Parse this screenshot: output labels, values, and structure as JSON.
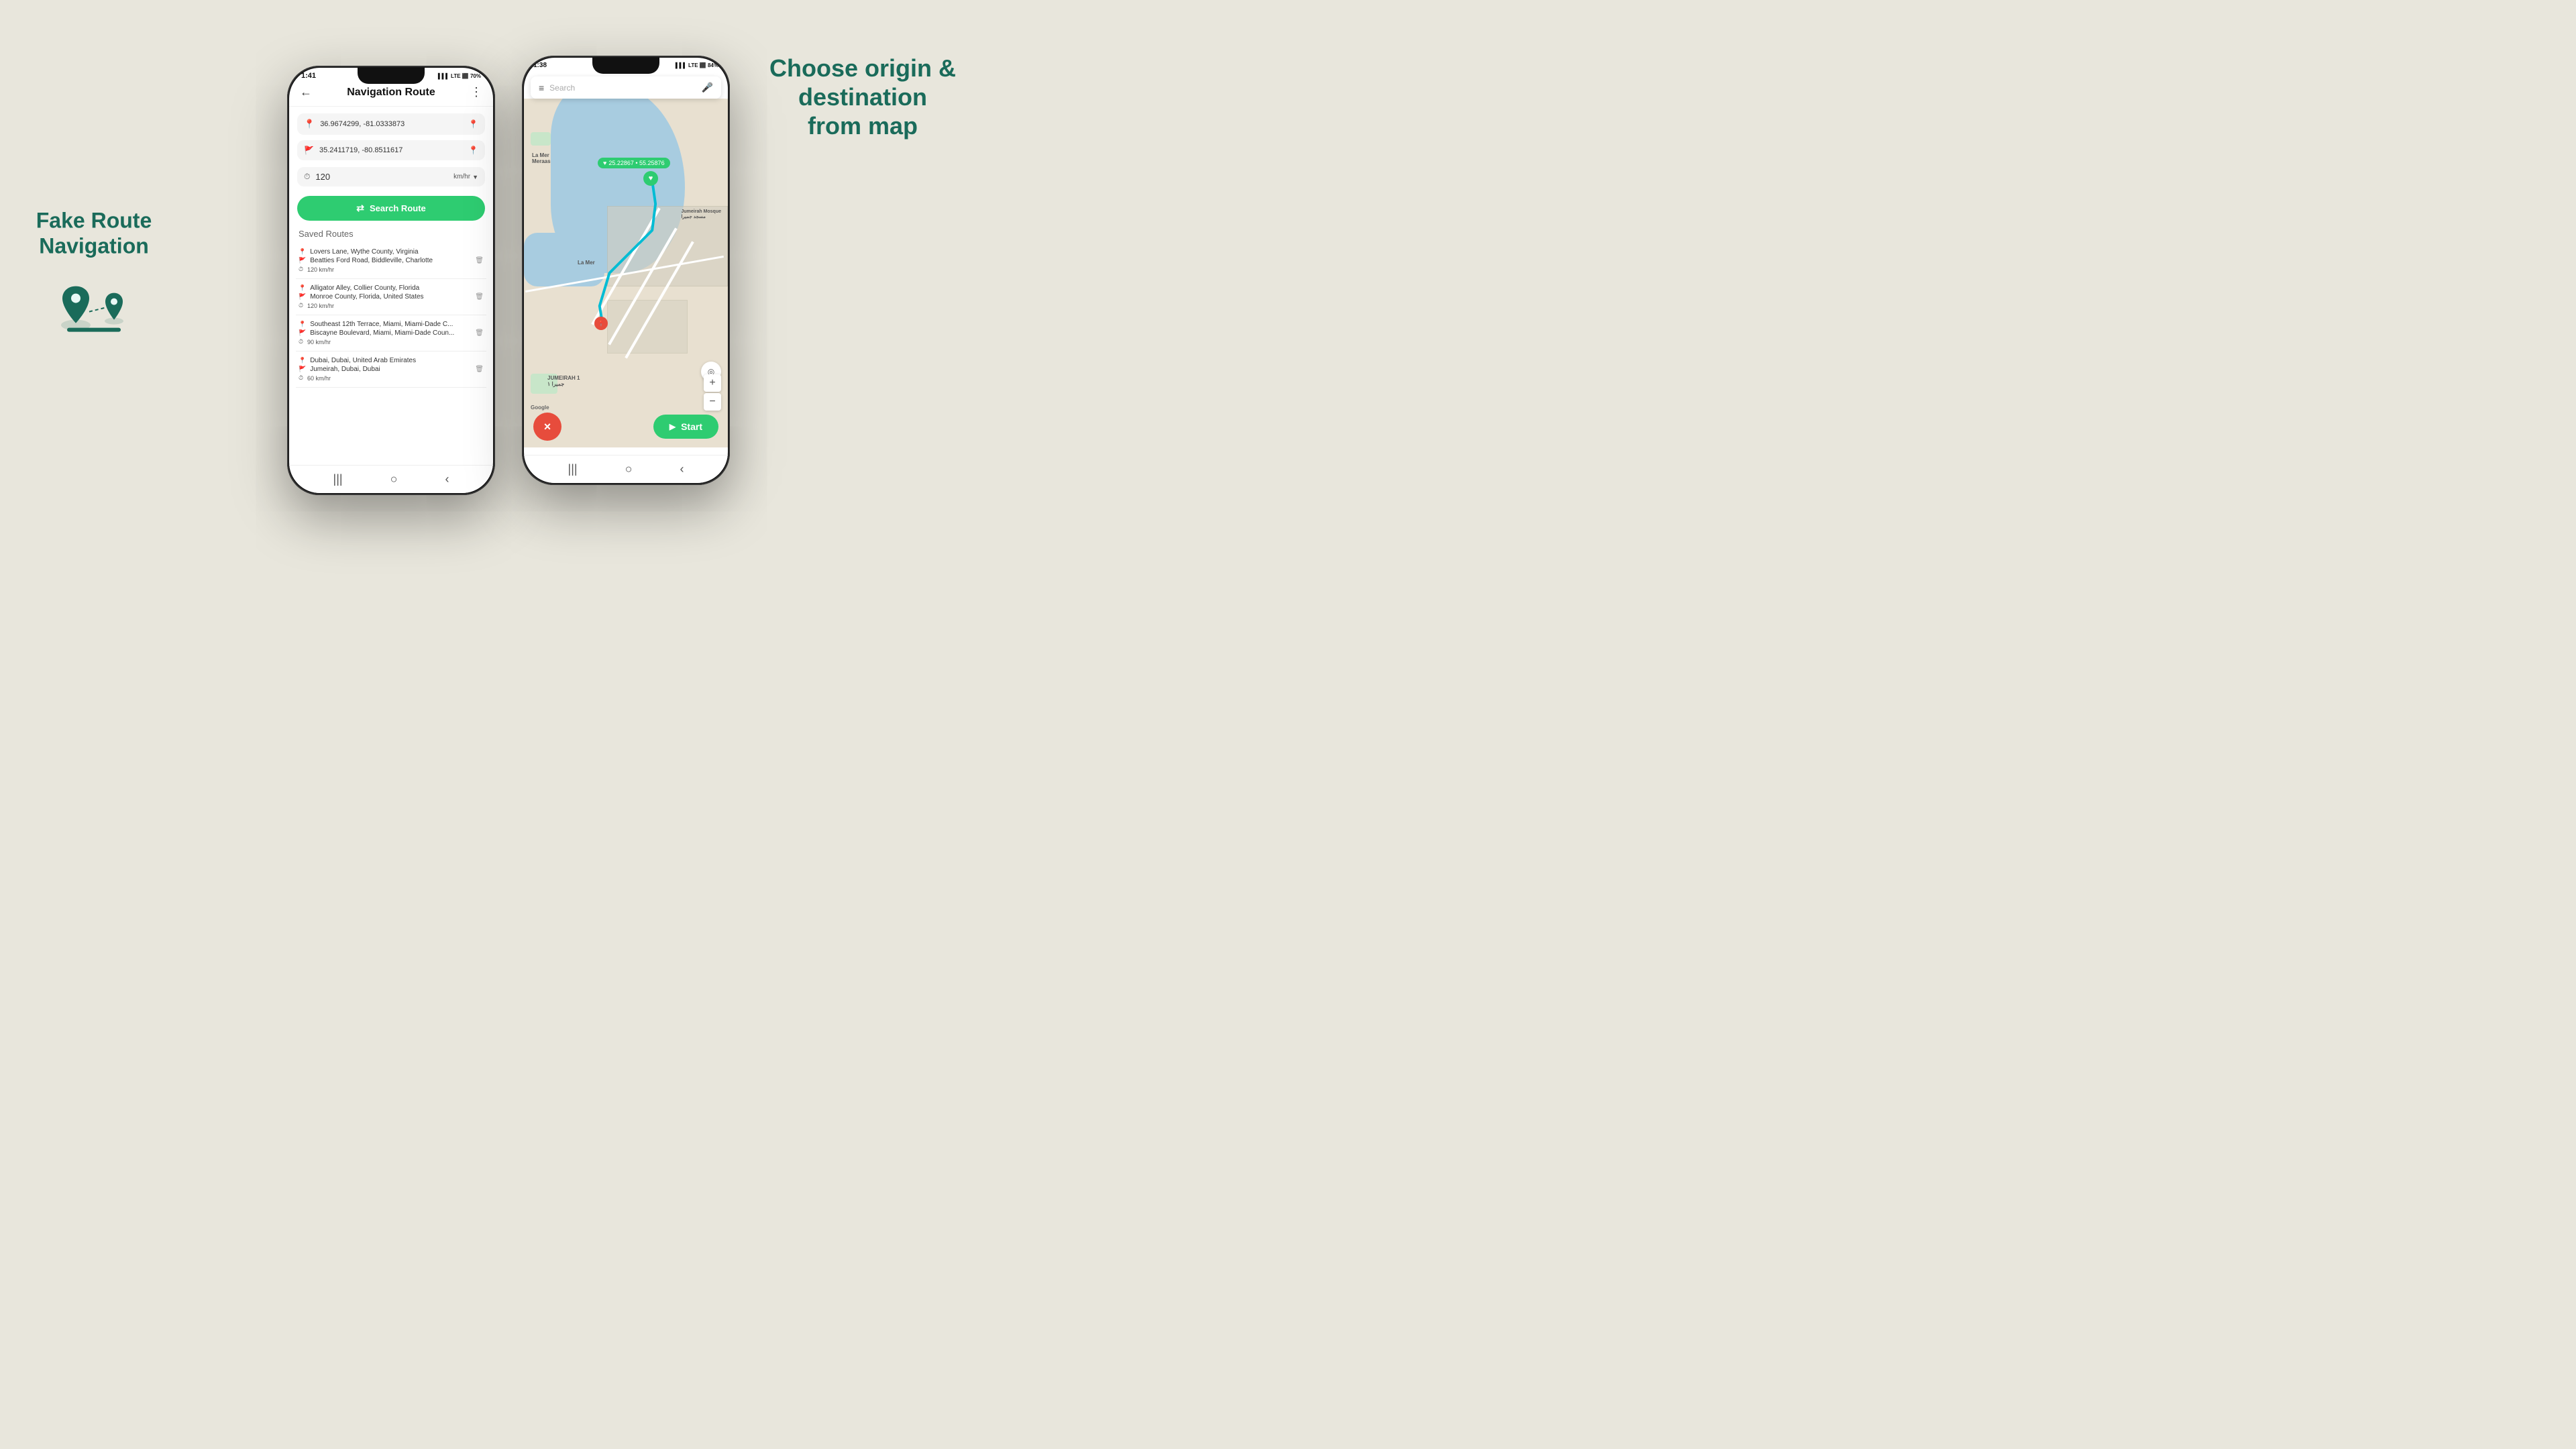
{
  "page": {
    "background": "#e8e6dc",
    "left_heading": "Fake Route\nNavigation",
    "right_heading": "Choose origin &\ndestination\nfrom map"
  },
  "phone1": {
    "status_time": "1:41",
    "status_icons": "▌▌▌ 4G LTE+ ⬛ 70%",
    "header": {
      "back_label": "←",
      "title": "Navigation Route",
      "more_label": "⋮"
    },
    "origin": {
      "placeholder": "36.9674299, -81.0333873"
    },
    "destination": {
      "placeholder": "35.2411719, -80.8511617"
    },
    "speed": {
      "value": "120",
      "unit": "km/hr"
    },
    "search_button": "Search Route",
    "saved_routes_title": "Saved Routes",
    "routes": [
      {
        "origin": "Lovers Lane, Wythe County, Virginia",
        "destination": "Beatties Ford Road, Biddleville, Charlotte",
        "speed": "120 km/hr"
      },
      {
        "origin": "Alligator Alley, Collier County, Florida",
        "destination": "Monroe County, Florida, United States",
        "speed": "120 km/hr"
      },
      {
        "origin": "Southeast 12th Terrace, Miami, Miami-Dade C...",
        "destination": "Biscayne Boulevard, Miami, Miami-Dade Coun...",
        "speed": "90 km/hr"
      },
      {
        "origin": "Dubai, Dubai, United Arab Emirates",
        "destination": "Jumeirah, Dubai, Dubai",
        "speed": "60 km/hr"
      }
    ],
    "bottom_nav": [
      "|||",
      "○",
      "‹"
    ]
  },
  "phone2": {
    "status_time": "1:38",
    "status_icons": "▌▌▌ 4G LTE+ ⬛ 84%",
    "search_placeholder": "Search",
    "coords_label": "25.22867 • 55.25876",
    "map_labels": [
      "La Mer",
      "Meraas",
      "Jumeirah Mosque",
      "La Mer",
      "JUMEIRAH 1",
      "جميرا ١"
    ],
    "cancel_label": "×",
    "start_label": "Start",
    "google_label": "Google",
    "zoom_plus": "+",
    "zoom_minus": "−",
    "bottom_nav": [
      "|||",
      "○",
      "‹"
    ]
  }
}
